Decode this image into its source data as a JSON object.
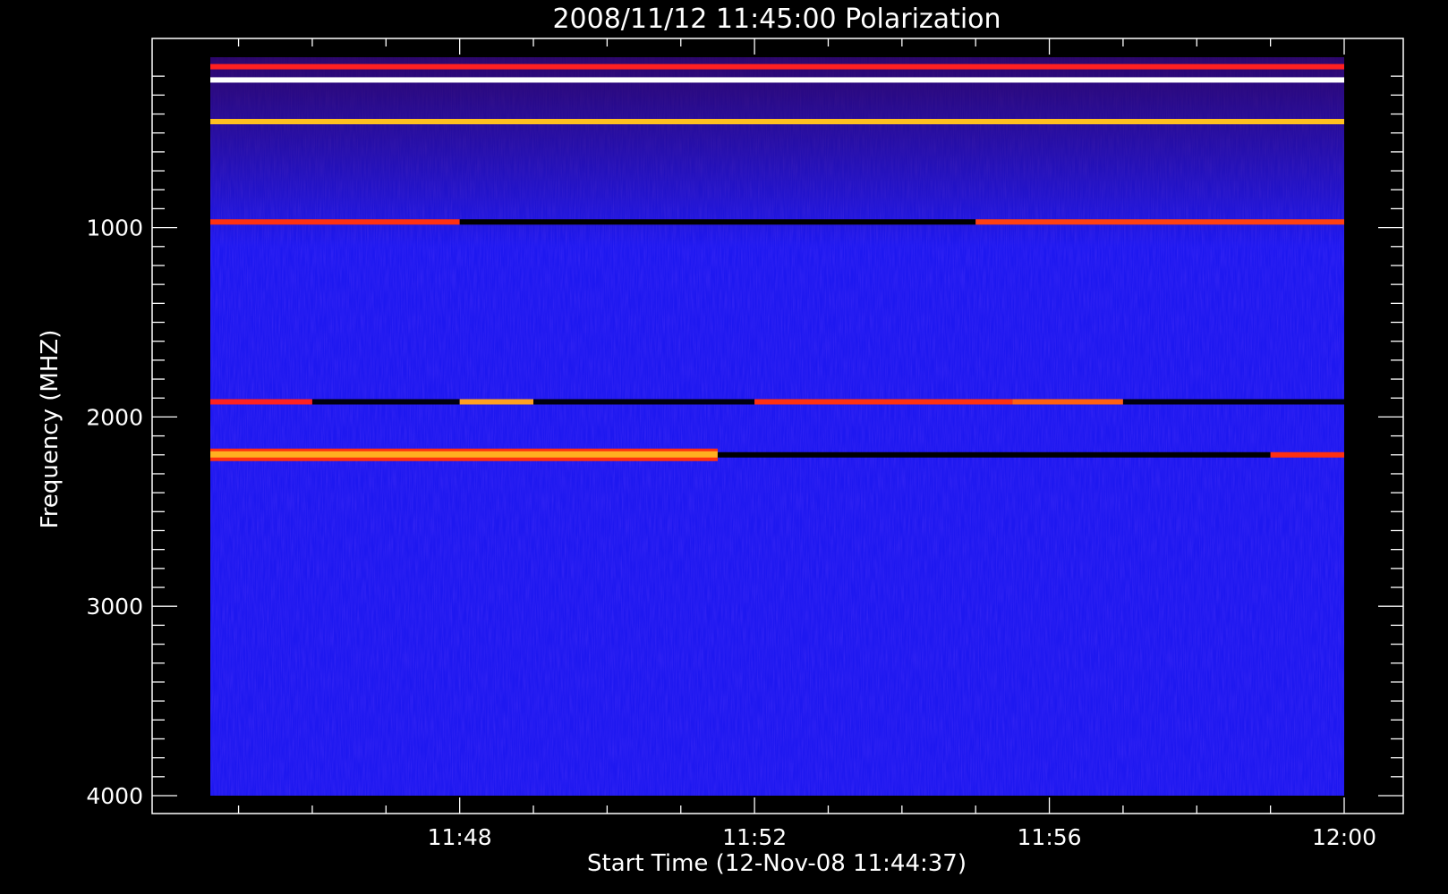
{
  "chart_data": {
    "type": "heatmap",
    "title": "2008/11/12 11:45:00 Polarization",
    "xlabel": "Start Time (12-Nov-08 11:44:37)",
    "ylabel": "Frequency (MHZ)",
    "xlim": [
      "11:44:37",
      "12:00:00"
    ],
    "ylim": [
      4000,
      100
    ],
    "y_inverted": true,
    "x_ticks": [
      "11:48",
      "11:52",
      "11:56",
      "12:00"
    ],
    "y_ticks": [
      1000,
      2000,
      3000,
      4000
    ],
    "background_color": "#1e18f0",
    "features": [
      {
        "band": "rfi-band",
        "freq_mhz": 2200,
        "segments": [
          {
            "t_start": "11:44:37",
            "t_end": "11:51:30",
            "color": "#ffb020",
            "edge_color": "#ff3010"
          },
          {
            "t_start": "11:51:30",
            "t_end": "11:59:00",
            "color": "#000000"
          },
          {
            "t_start": "11:59:00",
            "t_end": "12:00:00",
            "color": "#ff3010"
          }
        ]
      },
      {
        "band": "rfi-band",
        "freq_mhz": 1920,
        "segments": [
          {
            "t_start": "11:44:37",
            "t_end": "11:46:00",
            "color": "#ff2020"
          },
          {
            "t_start": "11:46:00",
            "t_end": "11:48:00",
            "color": "#000010"
          },
          {
            "t_start": "11:48:00",
            "t_end": "11:49:00",
            "color": "#ffa020"
          },
          {
            "t_start": "11:49:00",
            "t_end": "11:52:00",
            "color": "#000010"
          },
          {
            "t_start": "11:52:00",
            "t_end": "11:55:30",
            "color": "#ff3010"
          },
          {
            "t_start": "11:55:30",
            "t_end": "11:57:00",
            "color": "#ff6010"
          },
          {
            "t_start": "11:57:00",
            "t_end": "12:00:00",
            "color": "#000010"
          }
        ]
      },
      {
        "band": "rfi-band",
        "freq_mhz": 970,
        "segments": [
          {
            "t_start": "11:44:37",
            "t_end": "11:48:00",
            "color": "#ff3010"
          },
          {
            "t_start": "11:48:00",
            "t_end": "11:55:00",
            "color": "#000000"
          },
          {
            "t_start": "11:55:00",
            "t_end": "12:00:00",
            "color": "#ff4010"
          }
        ]
      },
      {
        "band": "rfi-band",
        "freq_mhz": 440,
        "segments": [
          {
            "t_start": "11:44:37",
            "t_end": "12:00:00",
            "color": "#ffc020"
          }
        ]
      },
      {
        "band": "rfi-band",
        "freq_mhz": 220,
        "segments": [
          {
            "t_start": "11:44:37",
            "t_end": "12:00:00",
            "color": "#ffffff"
          }
        ]
      },
      {
        "band": "rfi-band",
        "freq_mhz": 150,
        "segments": [
          {
            "t_start": "11:44:37",
            "t_end": "12:00:00",
            "color": "#ff2020"
          }
        ]
      }
    ]
  }
}
